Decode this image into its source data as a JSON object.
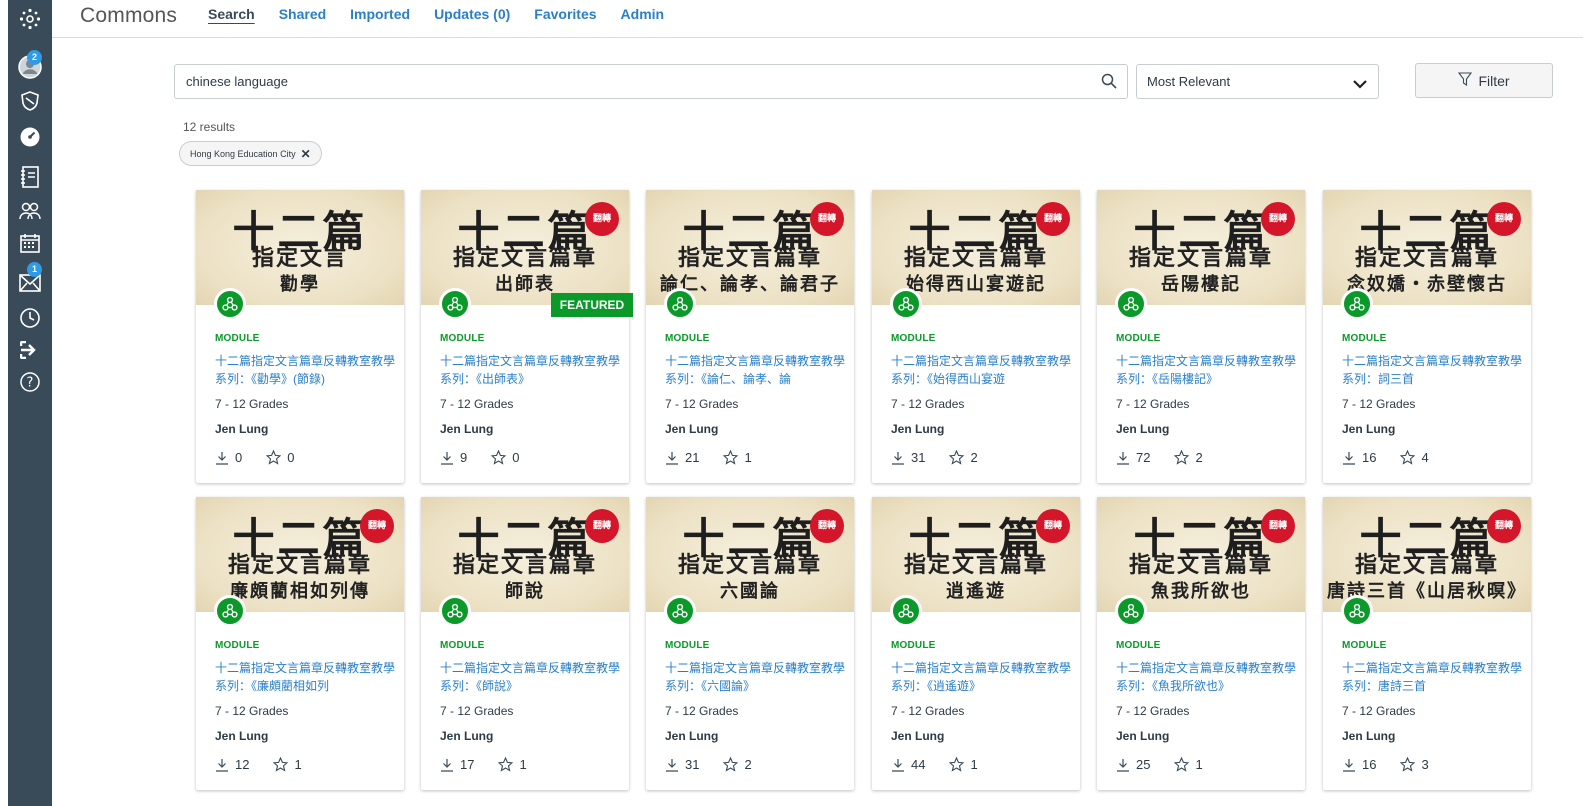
{
  "nav": {
    "profile_badge": "2",
    "inbox_badge": "1"
  },
  "header": {
    "brand": "Commons",
    "tabs": [
      "Search",
      "Shared",
      "Imported",
      "Updates (0)",
      "Favorites",
      "Admin"
    ],
    "active_tab": "Search"
  },
  "search": {
    "value": "chinese language",
    "sort": "Most Relevant",
    "filter_label": "Filter",
    "results_count": "12 results",
    "chip_label": "Hong Kong Education City"
  },
  "colors": {
    "sidebar": "#394b58",
    "link": "#2a7fc9",
    "green": "#0b9a2a",
    "badge": "#2d9be8"
  },
  "cards": [
    {
      "thumb_big": "十二篇",
      "thumb_sub": "指定文言",
      "thumb_line3": "勸學",
      "seal": "",
      "type": "MODULE",
      "title": "十二篇指定文言篇章反轉教室教學系列：《勸學》(節錄)",
      "grades": "7 - 12 Grades",
      "author": "Jen Lung",
      "downloads": "0",
      "favorites": "0",
      "featured": ""
    },
    {
      "thumb_big": "十二篇",
      "thumb_sub": "指定文言篇章",
      "thumb_line3": "出師表",
      "seal": "翻轉",
      "type": "MODULE",
      "title": "十二篇指定文言篇章反轉教室教學系列：《出師表》",
      "grades": "7 - 12 Grades",
      "author": "Jen Lung",
      "downloads": "9",
      "favorites": "0",
      "featured": "FEATURED"
    },
    {
      "thumb_big": "十二篇",
      "thumb_sub": "指定文言篇章",
      "thumb_line3": "論仁、論孝、論君子",
      "seal": "翻轉",
      "type": "MODULE",
      "title": "十二篇指定文言篇章反轉教室教學系列：《論仁、論孝、論",
      "grades": "7 - 12 Grades",
      "author": "Jen Lung",
      "downloads": "21",
      "favorites": "1",
      "featured": ""
    },
    {
      "thumb_big": "十二篇",
      "thumb_sub": "指定文言篇章",
      "thumb_line3": "始得西山宴遊記",
      "seal": "翻轉",
      "type": "MODULE",
      "title": "十二篇指定文言篇章反轉教室教學系列：《始得西山宴遊",
      "grades": "7 - 12 Grades",
      "author": "Jen Lung",
      "downloads": "31",
      "favorites": "2",
      "featured": ""
    },
    {
      "thumb_big": "十二篇",
      "thumb_sub": "指定文言篇章",
      "thumb_line3": "岳陽樓記",
      "seal": "翻轉",
      "type": "MODULE",
      "title": "十二篇指定文言篇章反轉教室教學系列：《岳陽樓記》",
      "grades": "7 - 12 Grades",
      "author": "Jen Lung",
      "downloads": "72",
      "favorites": "2",
      "featured": ""
    },
    {
      "thumb_big": "十二篇",
      "thumb_sub": "指定文言篇章",
      "thumb_line3": "念奴嬌・赤壁懷古",
      "seal": "翻轉",
      "type": "MODULE",
      "title": "十二篇指定文言篇章反轉教室教學系列：詞三首",
      "grades": "7 - 12 Grades",
      "author": "Jen Lung",
      "downloads": "16",
      "favorites": "4",
      "featured": ""
    },
    {
      "thumb_big": "十二篇",
      "thumb_sub": "指定文言篇章",
      "thumb_line3": "廉頗藺相如列傳",
      "seal": "翻轉",
      "type": "MODULE",
      "title": "十二篇指定文言篇章反轉教室教學系列：《廉頗藺相如列",
      "grades": "7 - 12 Grades",
      "author": "Jen Lung",
      "downloads": "12",
      "favorites": "1",
      "featured": ""
    },
    {
      "thumb_big": "十二篇",
      "thumb_sub": "指定文言篇章",
      "thumb_line3": "師說",
      "seal": "翻轉",
      "type": "MODULE",
      "title": "十二篇指定文言篇章反轉教室教學系列：《師說》",
      "grades": "7 - 12 Grades",
      "author": "Jen Lung",
      "downloads": "17",
      "favorites": "1",
      "featured": ""
    },
    {
      "thumb_big": "十二篇",
      "thumb_sub": "指定文言篇章",
      "thumb_line3": "六國論",
      "seal": "翻轉",
      "type": "MODULE",
      "title": "十二篇指定文言篇章反轉教室教學系列：《六國論》",
      "grades": "7 - 12 Grades",
      "author": "Jen Lung",
      "downloads": "31",
      "favorites": "2",
      "featured": ""
    },
    {
      "thumb_big": "十二篇",
      "thumb_sub": "指定文言篇章",
      "thumb_line3": "逍遙遊",
      "seal": "翻轉",
      "type": "MODULE",
      "title": "十二篇指定文言篇章反轉教室教學系列：《逍遙遊》",
      "grades": "7 - 12 Grades",
      "author": "Jen Lung",
      "downloads": "44",
      "favorites": "1",
      "featured": ""
    },
    {
      "thumb_big": "十二篇",
      "thumb_sub": "指定文言篇章",
      "thumb_line3": "魚我所欲也",
      "seal": "翻轉",
      "type": "MODULE",
      "title": "十二篇指定文言篇章反轉教室教學系列：《魚我所欲也》",
      "grades": "7 - 12 Grades",
      "author": "Jen Lung",
      "downloads": "25",
      "favorites": "1",
      "featured": ""
    },
    {
      "thumb_big": "十二篇",
      "thumb_sub": "指定文言篇章",
      "thumb_line3": "唐詩三首《山居秋暝》",
      "seal": "翻轉",
      "type": "MODULE",
      "title": "十二篇指定文言篇章反轉教室教學系列：唐詩三首",
      "grades": "7 - 12 Grades",
      "author": "Jen Lung",
      "downloads": "16",
      "favorites": "3",
      "featured": ""
    }
  ]
}
